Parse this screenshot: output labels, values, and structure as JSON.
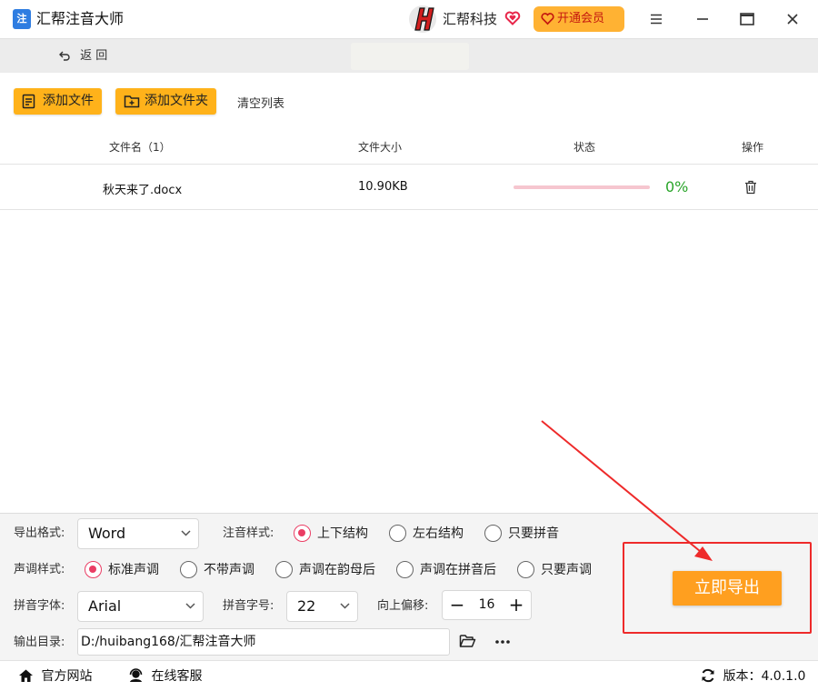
{
  "app": {
    "logo_text": "注",
    "title": "汇帮注音大师"
  },
  "brand": {
    "name": "汇帮科技",
    "vip_label": "开通会员"
  },
  "window": {
    "menu_icon": "menu-icon",
    "minimize_icon": "minimize-icon",
    "maximize_icon": "maximize-icon",
    "close_icon": "close-icon"
  },
  "nav": {
    "back_label": "返 回"
  },
  "toolbar": {
    "add_file": "添加文件",
    "add_folder": "添加文件夹",
    "clear_list": "清空列表"
  },
  "table": {
    "headers": {
      "name": "文件名（1）",
      "size": "文件大小",
      "status": "状态",
      "action": "操作"
    },
    "rows": [
      {
        "name": "秋天来了.docx",
        "size": "10.90KB",
        "progress": 0,
        "percent": "0%"
      }
    ]
  },
  "settings": {
    "export_format_label": "导出格式:",
    "export_format_value": "Word",
    "annotation_style_label": "注音样式:",
    "annotation_options": [
      "上下结构",
      "左右结构",
      "只要拼音"
    ],
    "annotation_selected": 0,
    "tone_style_label": "声调样式:",
    "tone_options": [
      "标准声调",
      "不带声调",
      "声调在韵母后",
      "声调在拼音后",
      "只要声调"
    ],
    "tone_selected": 0,
    "pinyin_font_label": "拼音字体:",
    "pinyin_font_value": "Arial",
    "pinyin_size_label": "拼音字号:",
    "pinyin_size_value": "22",
    "offset_label": "向上偏移:",
    "offset_minus": "−",
    "offset_value": "16",
    "offset_plus": "+",
    "output_dir_label": "输出目录:",
    "output_dir_value": "D:/huibang168/汇帮注音大师",
    "more_label": "···"
  },
  "export": {
    "label": "立即导出"
  },
  "footer": {
    "website": "官方网站",
    "support": "在线客服",
    "version_label": "版本：",
    "version": "4.0.1.0"
  },
  "colors": {
    "accent_orange": "#ffb21a",
    "export_orange": "#ff9f1f",
    "radio_pink": "#ea3d64",
    "annotation_red": "#ee2a2a",
    "progress_green": "#2aa52a"
  }
}
